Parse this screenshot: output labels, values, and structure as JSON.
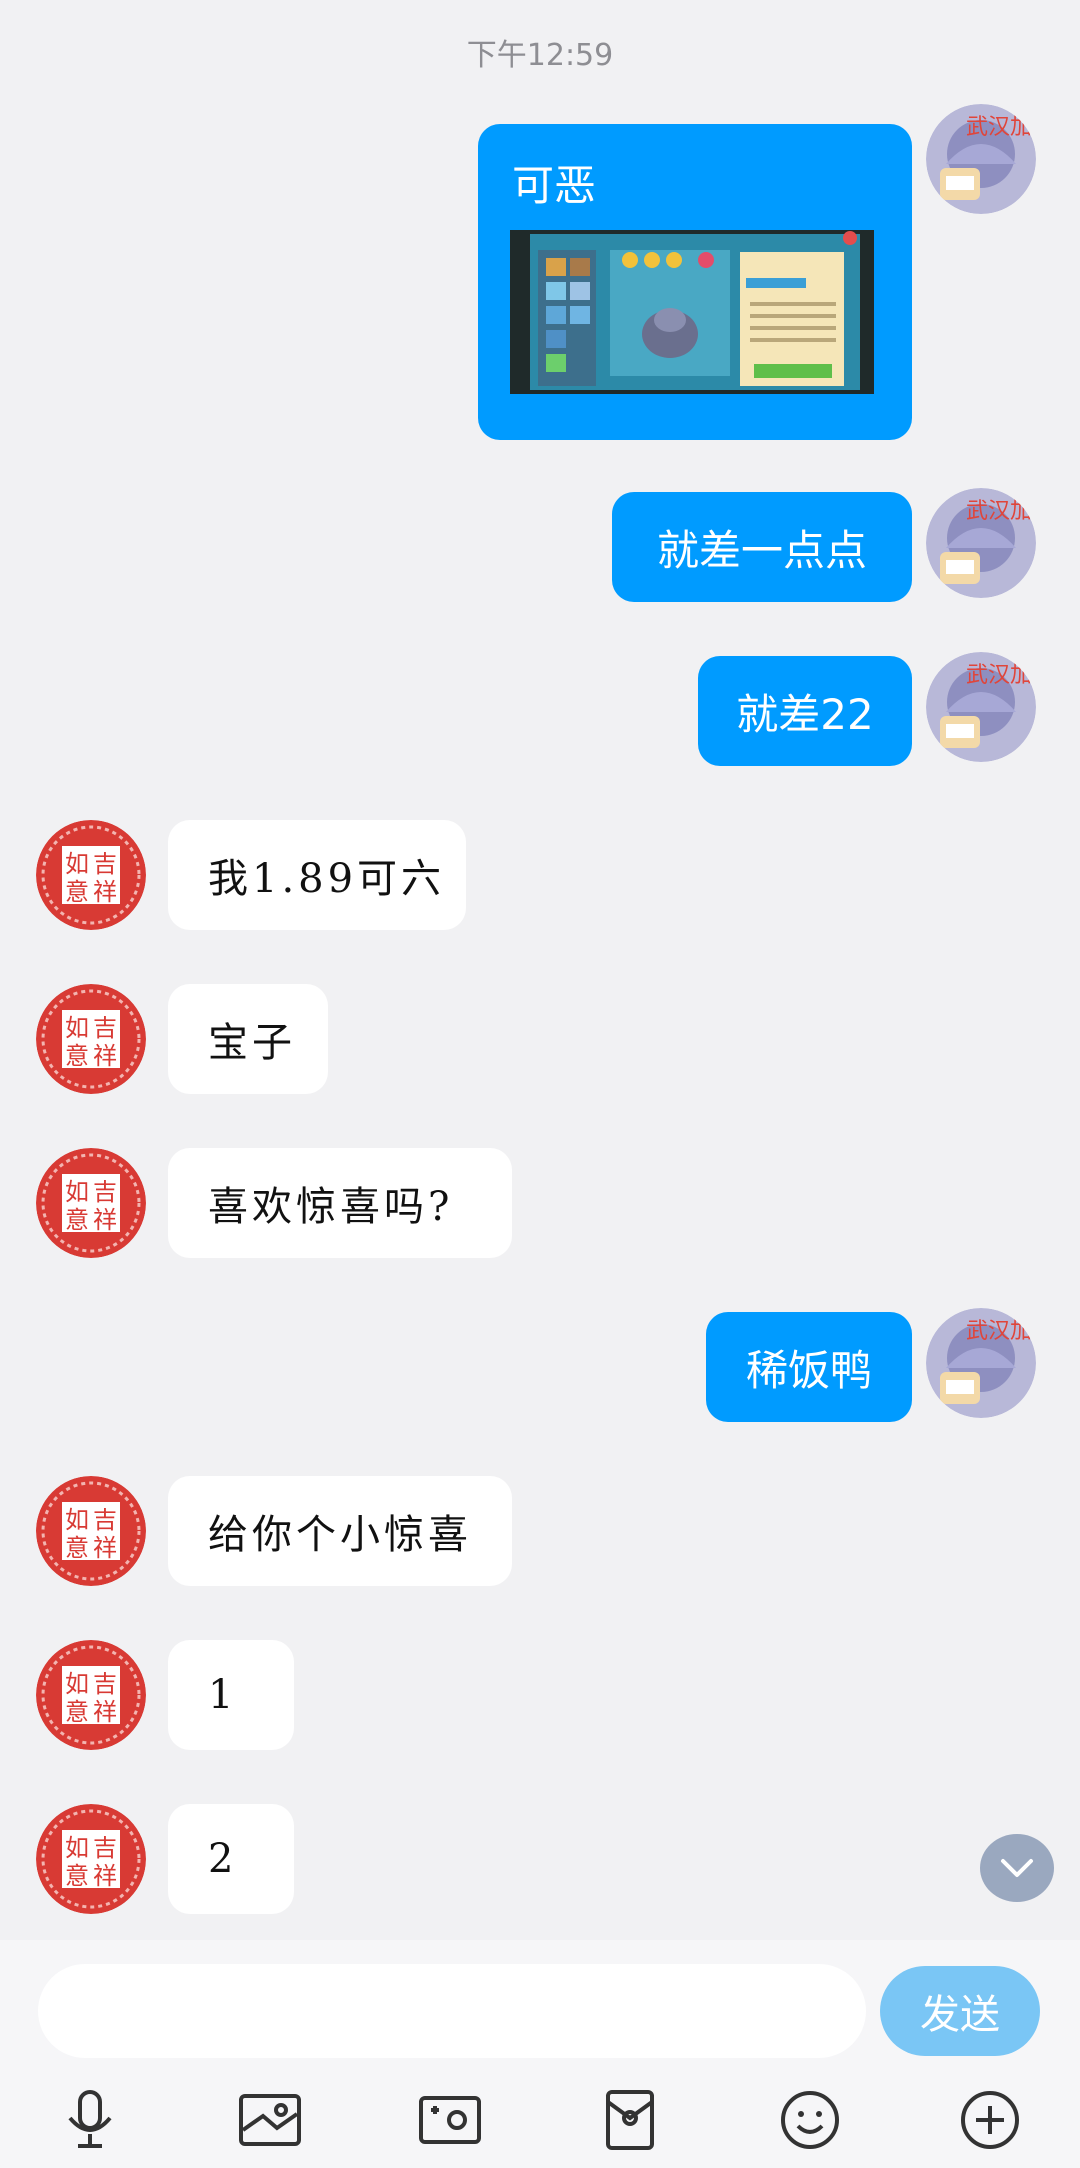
{
  "timestamp": "下午12:59",
  "messages": [
    {
      "dir": "out",
      "type": "image",
      "caption": "可恶"
    },
    {
      "dir": "out",
      "text": "就差一点点"
    },
    {
      "dir": "out",
      "text": "就差22"
    },
    {
      "dir": "in",
      "text": "我1.89可六"
    },
    {
      "dir": "in",
      "text": "宝子"
    },
    {
      "dir": "in",
      "text": "喜欢惊喜吗?"
    },
    {
      "dir": "out",
      "text": "稀饭鸭"
    },
    {
      "dir": "in",
      "text": "给你个小惊喜"
    },
    {
      "dir": "in",
      "text": "1"
    },
    {
      "dir": "in",
      "text": "2"
    }
  ],
  "avatars": {
    "me_sticker_text": "武汉加油",
    "contact_seal": [
      "吉",
      "如",
      "祥",
      "意"
    ]
  },
  "input": {
    "placeholder": "",
    "value": ""
  },
  "send_label": "发送",
  "toolbar": [
    "microphone-icon",
    "image-icon",
    "camera-icon",
    "red-packet-icon",
    "emoji-icon",
    "plus-icon"
  ],
  "colors": {
    "outgoing": "#009bff",
    "incoming": "#ffffff",
    "background": "#f1f1f3",
    "send_button": "#7ac6f5"
  }
}
